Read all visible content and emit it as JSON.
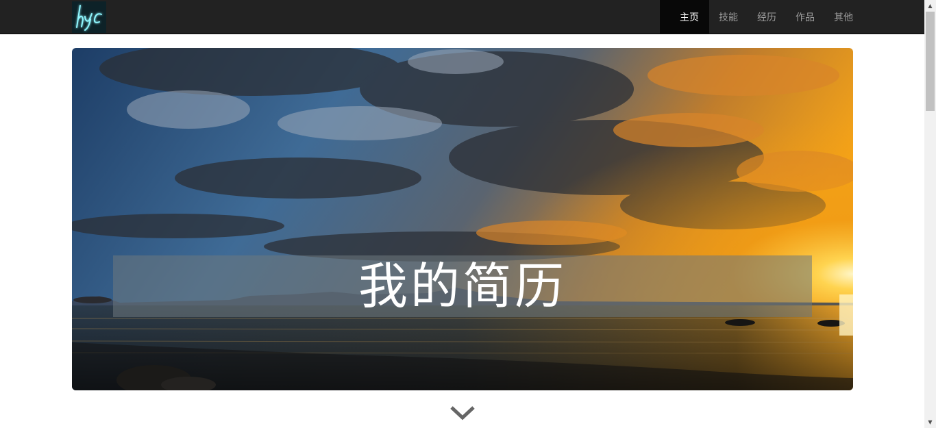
{
  "navbar": {
    "logo_text": "hyc",
    "items": [
      {
        "label": "主页",
        "active": true
      },
      {
        "label": "技能",
        "active": false
      },
      {
        "label": "经历",
        "active": false
      },
      {
        "label": "作品",
        "active": false
      },
      {
        "label": "其他",
        "active": false
      }
    ]
  },
  "hero": {
    "title": "我的简历"
  },
  "colors": {
    "navbar_bg": "#222222",
    "nav_active_bg": "#080808",
    "nav_text": "#9d9d9d",
    "nav_active_text": "#ffffff",
    "logo_glow": "#7ff4ff",
    "chevron": "#666666"
  },
  "icons": {
    "scroll_down": "chevron-down-icon",
    "scrollbar_up": "triangle-up-icon",
    "scrollbar_down": "triangle-down-icon"
  }
}
